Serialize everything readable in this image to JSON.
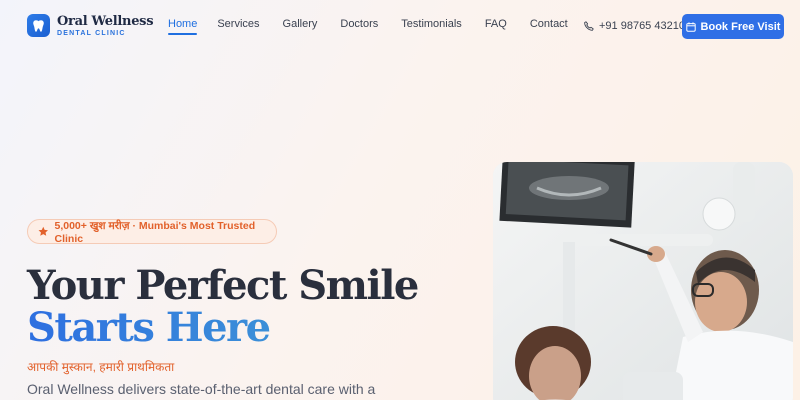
{
  "brand": {
    "title": "Oral Wellness",
    "subtitle": "DENTAL CLINIC",
    "icon": "tooth-icon",
    "accent": "#2f6fe6"
  },
  "nav": {
    "items": [
      {
        "label": "Home",
        "active": true
      },
      {
        "label": "Services",
        "active": false
      },
      {
        "label": "Gallery",
        "active": false
      },
      {
        "label": "Doctors",
        "active": false
      },
      {
        "label": "Testimonials",
        "active": false
      },
      {
        "label": "FAQ",
        "active": false
      },
      {
        "label": "Contact",
        "active": false
      }
    ],
    "phone": "+91 98765 43210",
    "phone_icon": "phone-icon",
    "cta_label": "Book Free Visit",
    "cta_icon": "calendar-icon"
  },
  "hero": {
    "badge_text": "5,000+ खुश मरीज़ · Mumbai's Most Trusted Clinic",
    "badge_icon": "star-icon",
    "headline_line1": "Your Perfect Smile",
    "headline_line2": "Starts Here",
    "tagline": "आपकी मुस्कान, हमारी प्राथमिकता",
    "description": "Oral Wellness delivers state-of-the-art dental care with a",
    "highlight_color": "#e2612b"
  }
}
